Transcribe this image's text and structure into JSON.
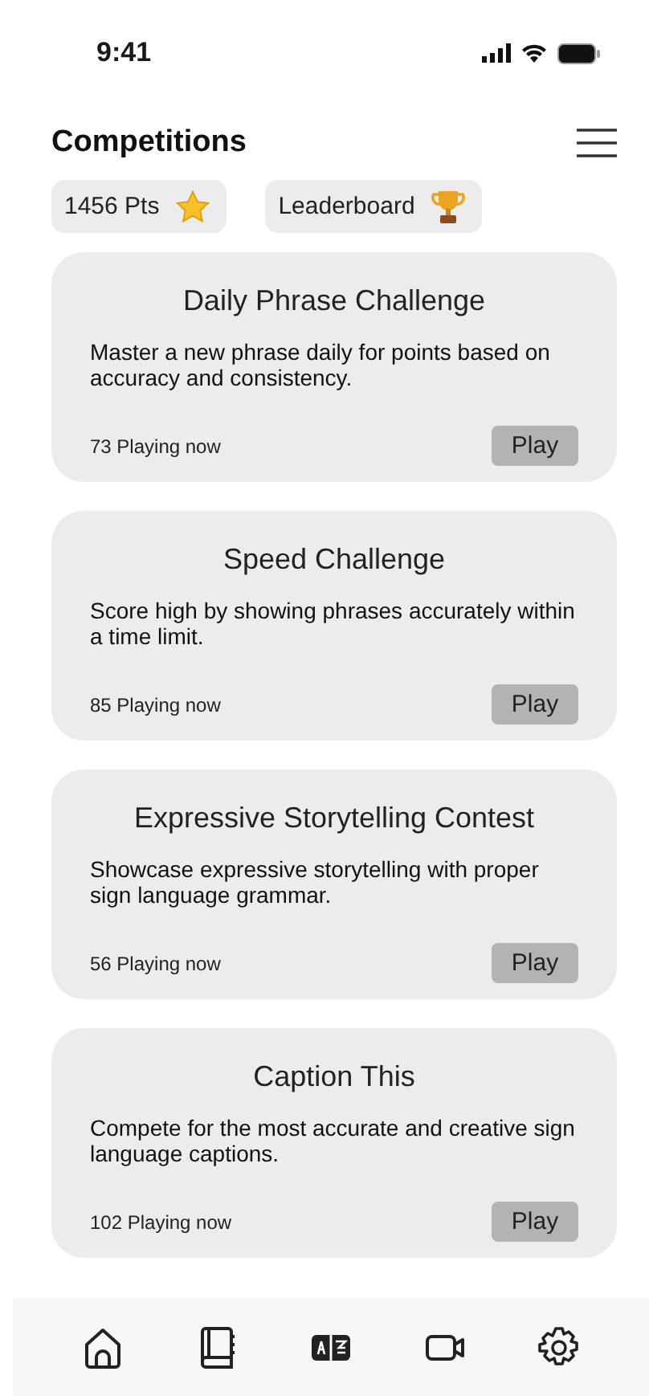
{
  "status_bar": {
    "time": "9:41"
  },
  "header": {
    "title": "Competitions"
  },
  "chips": [
    {
      "label": "1456 Pts",
      "kind": "points"
    },
    {
      "label": "Leaderboard",
      "kind": "leaderboard"
    }
  ],
  "competitions": [
    {
      "title": "Daily Phrase Challenge",
      "description": "Master a new phrase daily for points based on accuracy and consistency.",
      "players": "73 Playing now",
      "button": "Play"
    },
    {
      "title": "Speed Challenge",
      "description": "Score high by showing phrases accurately within a time limit.",
      "players": "85 Playing now",
      "button": "Play"
    },
    {
      "title": "Expressive Storytelling Contest",
      "description": "Showcase expressive storytelling with proper sign language grammar.",
      "players": "56 Playing now",
      "button": "Play"
    },
    {
      "title": "Caption This",
      "description": "Compete for the most accurate and creative sign language captions.",
      "players": "102 Playing now",
      "button": "Play"
    }
  ],
  "nav": [
    {
      "kind": "home"
    },
    {
      "kind": "book"
    },
    {
      "kind": "translate"
    },
    {
      "kind": "video"
    },
    {
      "kind": "settings"
    }
  ]
}
